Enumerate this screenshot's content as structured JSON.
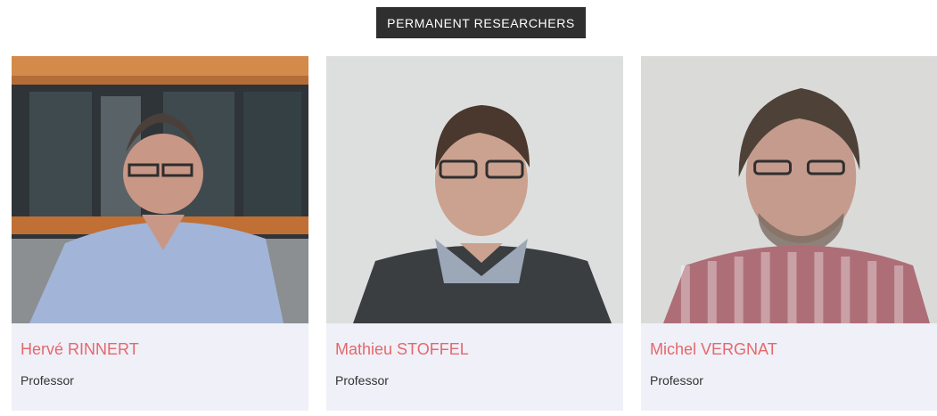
{
  "section": {
    "label": "PERMANENT RESEARCHERS"
  },
  "researchers": [
    {
      "name": "Hervé RINNERT",
      "title": "Professor"
    },
    {
      "name": "Mathieu STOFFEL",
      "title": "Professor"
    },
    {
      "name": "Michel VERGNAT",
      "title": "Professor"
    }
  ],
  "colors": {
    "label_bg": "#2f2f2f",
    "name_color": "#e4686b",
    "info_bg": "#f0f0f8"
  }
}
